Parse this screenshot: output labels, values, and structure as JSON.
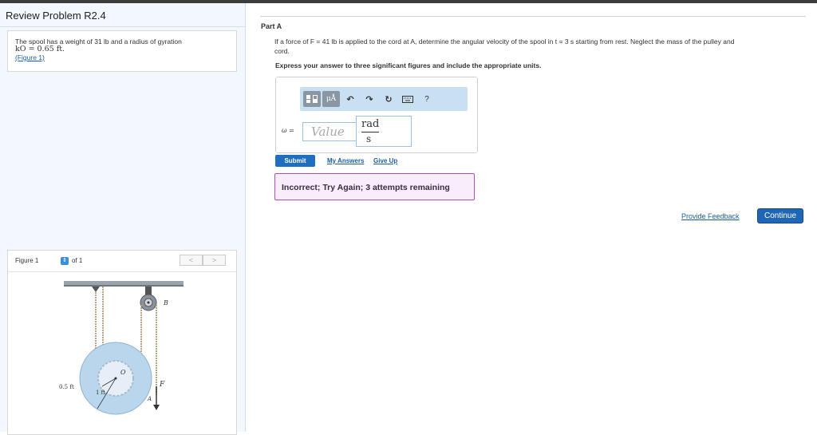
{
  "left_panel": {
    "title": "Review Problem R2.4",
    "problem_line1": "The spool has a weight of 31 lb and a radius of gyration",
    "problem_line2": "kO = 0.65 ft.",
    "figure_link": "(Figure 1)",
    "figure_nav": {
      "label": "Figure 1",
      "of_text": "of 1",
      "prev_glyph": "<",
      "next_glyph": ">"
    },
    "figure_labels": {
      "point_b": "B",
      "point_o": "O",
      "point_a": "A",
      "force": "F",
      "inner_radius": "0.5 ft",
      "outer_radius": "1 ft"
    }
  },
  "part": {
    "label": "Part A",
    "question_line1": "If a force of F = 41 lb is applied to the cord at A, determine the angular velocity of the spool in t = 3 s starting from rest. Neglect the mass of the pulley and",
    "question_line2": "cord.",
    "instruction": "Express your answer to three significant figures and include the appropriate units.",
    "omega_label": "ω =",
    "value_placeholder": "Value",
    "unit_numerator": "rad",
    "unit_denominator": "s",
    "toolbar": {
      "mu_label": "μÅ",
      "help_label": "?"
    },
    "submit_label": "Submit",
    "my_answers_label": "My Answers",
    "give_up_label": "Give Up",
    "feedback_text": "Incorrect; Try Again; 3 attempts remaining"
  },
  "footer": {
    "provide_feedback": "Provide Feedback",
    "continue_label": "Continue"
  },
  "colors": {
    "left_bg": "#f2f8fd",
    "toolbar_bg": "#c9dff2",
    "submit_bg": "#1e6fbf",
    "feedback_border": "#b04cbf",
    "feedback_bg": "#f8eefa",
    "spool_fill": "#b9d6ec"
  }
}
